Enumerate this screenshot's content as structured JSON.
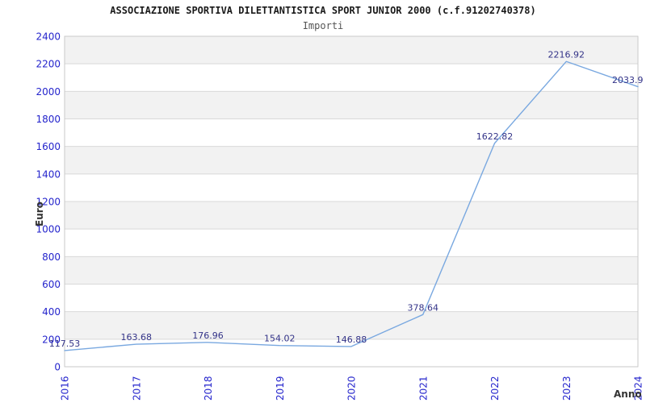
{
  "title": "ASSOCIAZIONE SPORTIVA DILETTANTISTICA SPORT JUNIOR 2000 (c.f.91202740378)",
  "subtitle": "Importi",
  "chart_data": {
    "type": "line",
    "title": "ASSOCIAZIONE SPORTIVA DILETTANTISTICA SPORT JUNIOR 2000 (c.f.91202740378)",
    "subtitle": "Importi",
    "xlabel": "Anno",
    "ylabel": "Euro",
    "categories": [
      "2016",
      "2017",
      "2018",
      "2019",
      "2020",
      "2021",
      "2022",
      "2023",
      "2024"
    ],
    "values": [
      117.53,
      163.68,
      176.96,
      154.02,
      146.88,
      378.64,
      1622.82,
      2216.92,
      2033.9
    ],
    "point_labels": [
      "117.53",
      "163.68",
      "176.96",
      "154.02",
      "146.88",
      "378.64",
      "1622.82",
      "2216.92",
      "2033.9"
    ],
    "ylim": [
      0,
      2400
    ],
    "ytick_step": 200,
    "grid": "horizontal",
    "background_bands": "alternating",
    "legend": "none",
    "colors": {
      "line": "#79a8e0",
      "tick_label": "#2424cc",
      "data_label": "#333388",
      "band": "#f2f2f2",
      "gridline": "#d9d9d9",
      "plot_border": "#c9c9c9",
      "axis_title": "#333333",
      "title": "#1a1a1a",
      "subtitle": "#555555"
    }
  }
}
